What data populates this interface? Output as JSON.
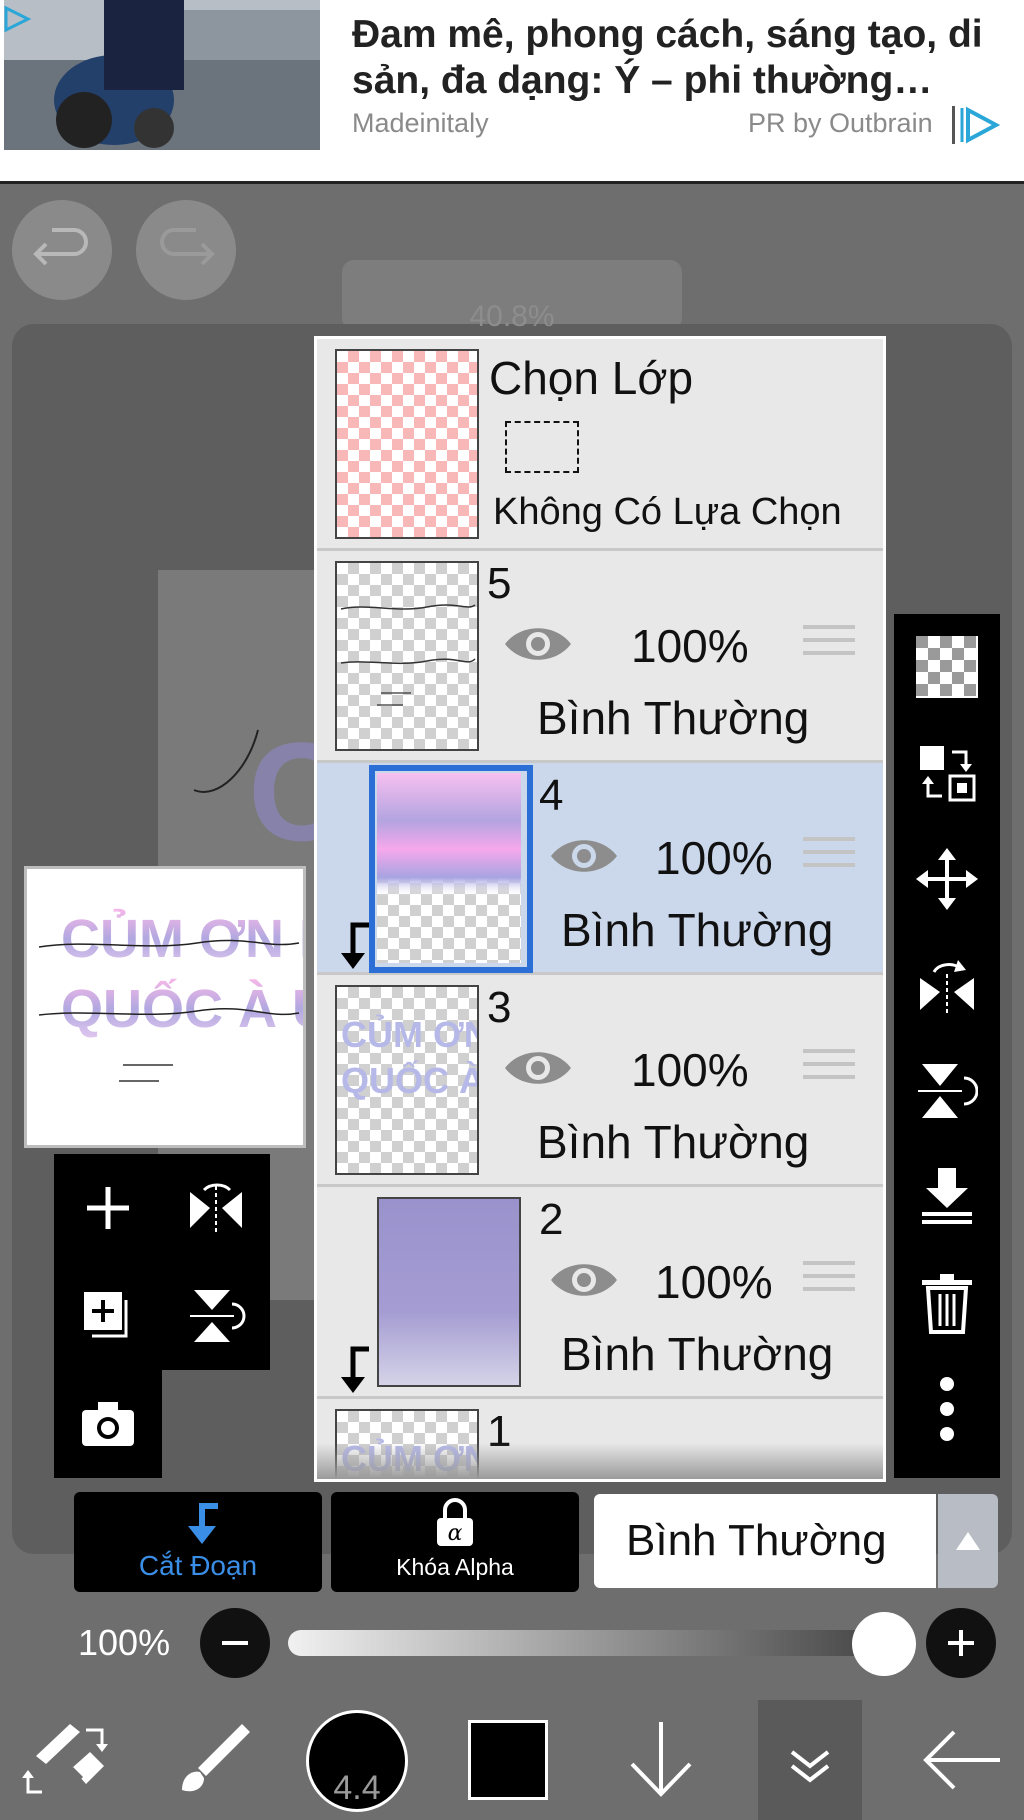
{
  "ad": {
    "title": "Đam mê, phong cách, sáng tạo, di sản, đa dạng: Ý – phi thường…",
    "source": "Madeinitaly",
    "sponsor": "PR by Outbrain"
  },
  "canvas": {
    "zoom_label": "40.8%"
  },
  "layers_panel": {
    "selection_layer": {
      "title": "Chọn Lớp",
      "status": "Không Có Lựa Chọn"
    },
    "layers": [
      {
        "number": "5",
        "opacity": "100%",
        "blend": "Bình Thường"
      },
      {
        "number": "4",
        "opacity": "100%",
        "blend": "Bình Thường"
      },
      {
        "number": "3",
        "opacity": "100%",
        "blend": "Bình Thường"
      },
      {
        "number": "2",
        "opacity": "100%",
        "blend": "Bình Thường"
      },
      {
        "number": "1"
      }
    ]
  },
  "thumbnail_text": {
    "line1": "CỦM ƠN BN",
    "line2": "QUỐC À UJ"
  },
  "layer_controls": {
    "clipping_label": "Cắt Đoạn",
    "alpha_lock_label": "Khóa Alpha",
    "blend_mode": "Bình Thường",
    "opacity_label": "100%"
  },
  "brush": {
    "size": "4.4"
  },
  "colors": {
    "accent_blue": "#3a8ee6",
    "selected_layer_bg": "#cbd8ec",
    "selection_thumb_pink": "#f8b8b8"
  },
  "icons": [
    "undo-icon",
    "redo-icon",
    "eye-icon",
    "drag-handle-icon",
    "checker-icon",
    "swap-layer-icon",
    "move-icon",
    "flip-horizontal-icon",
    "flip-vertical-icon",
    "merge-down-icon",
    "trash-icon",
    "more-vertical-icon",
    "plus-icon",
    "flip-rotate-icon",
    "add-layer-icon",
    "camera-icon",
    "clip-arrow-icon",
    "lock-alpha-icon",
    "minus-icon",
    "eraser-swap-icon",
    "brush-icon",
    "arrow-down-icon",
    "chevron-double-down-icon",
    "back-arrow-icon"
  ]
}
